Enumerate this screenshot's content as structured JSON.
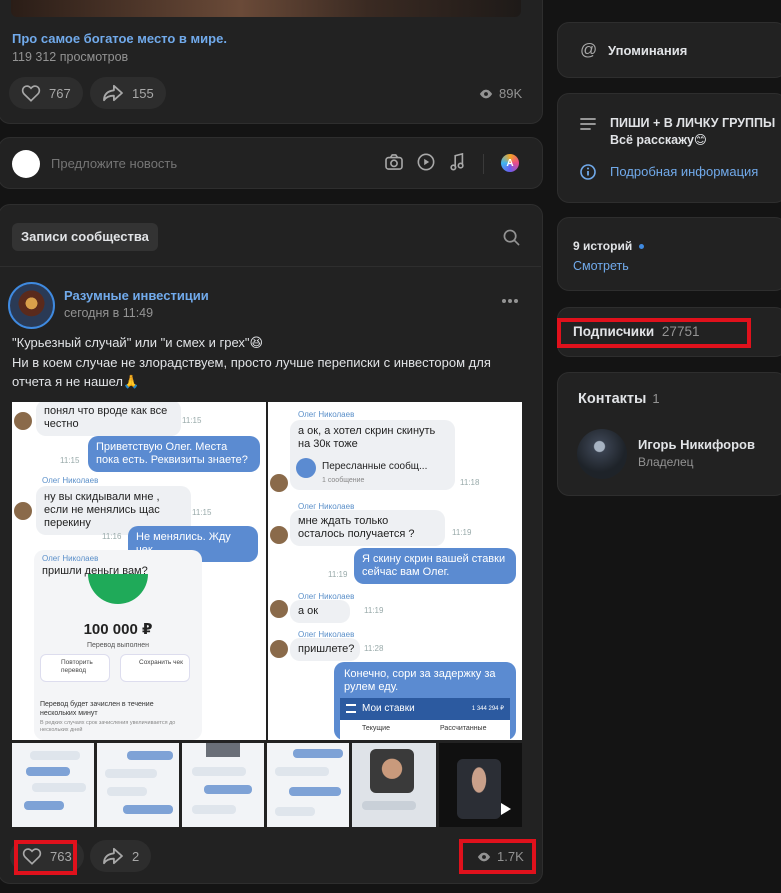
{
  "top_post": {
    "caption_link": "Про самое богатое место в мире.",
    "views_text": "119 312 просмотров",
    "likes": "767",
    "shares": "155",
    "views": "89K"
  },
  "suggest": {
    "placeholder": "Предложите новость",
    "icons": [
      "camera-icon",
      "play-icon",
      "music-icon",
      "ai-icon"
    ]
  },
  "wall": {
    "tab_label": "Записи сообщества",
    "post": {
      "author": "Разумные инвестиции",
      "time": "сегодня в 11:49",
      "text_line1": "\"Курьезный случай\" или \"и смех и грех\"😆",
      "text_line2": "Ни в коем случае не злорадствуем, просто лучше переписки с инвестором для",
      "text_line3": "отчета я не нашел🙏",
      "likes": "763",
      "shares": "2",
      "views": "1.7K"
    },
    "screenshot_left": {
      "msg1": "понял что вроде как все честно",
      "time1": "11:15",
      "msg2": "Приветствую Олег. Места пока есть. Реквизиты знаете?",
      "time2": "11:15",
      "name3": "Олег Николаев",
      "msg3": "ну вы скидывали мне , если не менялись щас перекину",
      "time3": "11:15",
      "time4": "11:16",
      "msg4": "Не менялись. Жду чек.",
      "name5": "Олег Николаев",
      "msg5": "пришли деньги вам?",
      "amount": "100 000 ₽",
      "transfer_status": "Перевод выполнен",
      "btn_repeat": "Повторить перевод",
      "btn_save": "Сохранить чек",
      "note1": "Перевод будет зачислен в течение нескольких минут",
      "note2": "В редких случаях срок зачисления увеличивается до нескольких дней"
    },
    "screenshot_right": {
      "name1": "Олег Николаев",
      "msg1": "а ок, а хотел скрин скинуть на 30к тоже",
      "forward_title": "Пересланные сообщ...",
      "forward_sub": "1 сообщение",
      "time1": "11:18",
      "name2": "Олег Николаев",
      "msg2": "мне ждать только осталось получается ?",
      "time2": "11:19",
      "msg3": "Я скину скрин вашей ставки сейчас вам Олег.",
      "time3": "11:19",
      "name4": "Олег Николаев",
      "msg4": "а ок",
      "time4": "11:19",
      "name5": "Олег Николаев",
      "msg5": "пришлете?",
      "time5": "11:28",
      "msg6": "Конечно, сори за задержку за рулем еду.",
      "app_title": "Мои ставки",
      "app_amount": "1 344 294 ₽",
      "app_tab1": "Текущие",
      "app_tab2": "Рассчитанные"
    }
  },
  "sidebar": {
    "mentions": "Упоминания",
    "info_line1": "ПИШИ + В ЛИЧКУ ГРУППЫ",
    "info_line2": "Всё расскажу😊",
    "details_link": "Подробная информация",
    "stories_count": "9 историй",
    "stories_link": "Смотреть",
    "subscribers_label": "Подписчики",
    "subscribers_count": "27751",
    "contacts_label": "Контакты",
    "contacts_count": "1",
    "contact_name": "Игорь Никифоров",
    "contact_role": "Владелец"
  },
  "colors": {
    "background": "#141414",
    "card": "#222222",
    "accent_link": "#71aaeb",
    "highlight_red": "#e0111c",
    "story_dot": "#3f8ae0"
  }
}
